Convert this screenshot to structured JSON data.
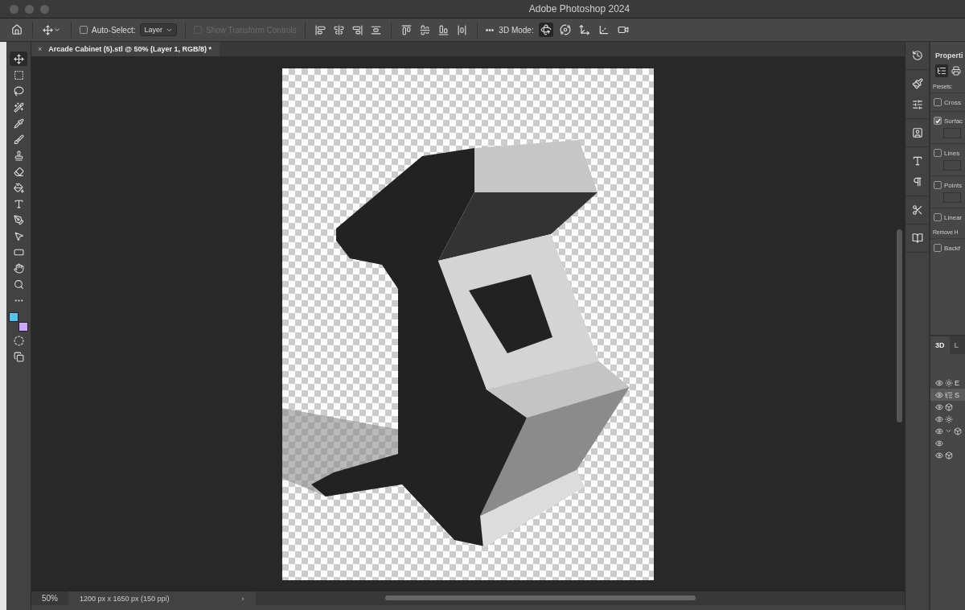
{
  "window": {
    "title": "Adobe Photoshop 2024"
  },
  "options_bar": {
    "auto_select": {
      "label": "Auto-Select:",
      "checked": false
    },
    "layer_dropdown": {
      "value": "Layer"
    },
    "transform_controls": {
      "label": "Show Transform Controls",
      "checked": false,
      "disabled": true
    },
    "more": "•••",
    "mode_label": "3D Mode:",
    "mode_buttons": [
      {
        "selected": true
      },
      {
        "selected": false
      },
      {
        "selected": false
      },
      {
        "selected": false
      },
      {
        "selected": false
      }
    ]
  },
  "document_tab": {
    "title": "Arcade Cabinet (5).stl @ 50% (Layer 1, RGB/8) *",
    "close": "×"
  },
  "tools": [
    {
      "selected": true
    },
    {
      "selected": false
    },
    {
      "selected": false
    },
    {
      "selected": false
    },
    {
      "selected": false
    },
    {
      "selected": false
    },
    {
      "selected": false
    },
    {
      "selected": false
    },
    {
      "selected": false
    },
    {
      "selected": false
    },
    {
      "selected": false
    },
    {
      "selected": false
    },
    {
      "selected": false
    },
    {
      "selected": false
    },
    {
      "selected": false
    },
    {
      "selected": false
    }
  ],
  "swatches": [
    {
      "color": "#5bc0e8"
    },
    {
      "color": "#c9a8f7"
    }
  ],
  "status_bar": {
    "zoom": "50%",
    "size": "1200 px x 1650 px (150 ppi)",
    "arrow": "›"
  },
  "properties": {
    "title": "Properti",
    "presets_label": "Presets:",
    "options": [
      {
        "kind": "checkbox",
        "label": "Cross",
        "checked": false,
        "swatch": false
      },
      {
        "kind": "checkbox",
        "label": "Surfac",
        "checked": true,
        "swatch": true
      },
      {
        "kind": "checkbox",
        "label": "Lines",
        "checked": false,
        "swatch": true
      },
      {
        "kind": "checkbox",
        "label": "Points",
        "checked": false,
        "swatch": true
      },
      {
        "kind": "checkbox",
        "label": "Linear",
        "checked": false,
        "swatch": false
      },
      {
        "kind": "text",
        "label": "Remove H"
      },
      {
        "kind": "checkbox",
        "label": "Backf",
        "checked": false,
        "swatch": false
      }
    ]
  },
  "layers_panel": {
    "tabs": [
      {
        "label": "3D",
        "selected": true
      },
      {
        "label": "L",
        "selected": false
      }
    ],
    "rows": [
      {
        "label": "E",
        "selected": false,
        "expanded": false
      },
      {
        "label": "S",
        "selected": true,
        "expanded": false
      },
      {
        "selected": false,
        "expanded": false
      },
      {
        "selected": false,
        "expanded": false
      },
      {
        "selected": false,
        "expanded": true
      },
      {
        "selected": false,
        "expanded": false
      },
      {
        "selected": false,
        "expanded": false
      }
    ]
  }
}
